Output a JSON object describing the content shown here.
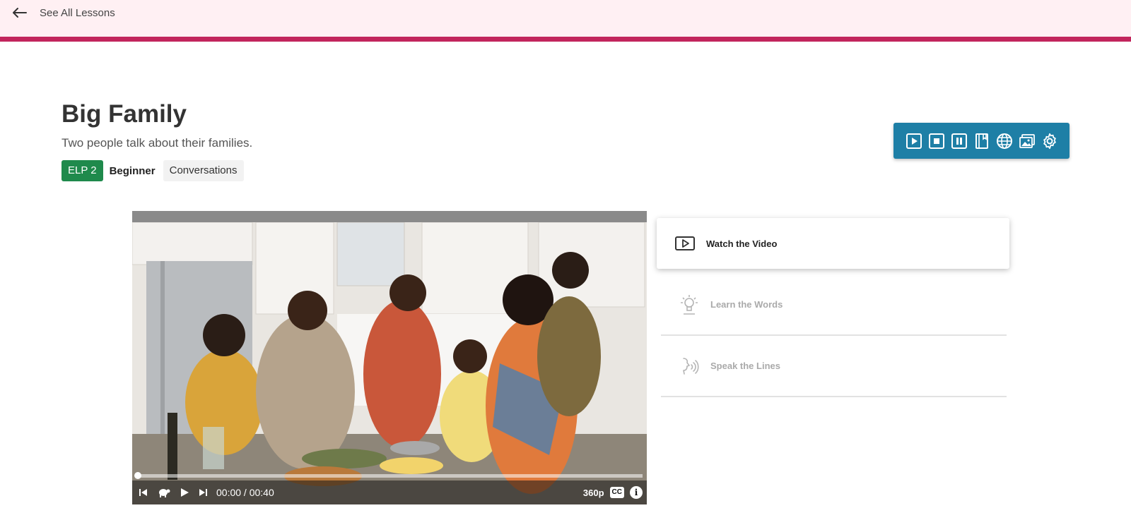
{
  "nav": {
    "back_label": "See All Lessons"
  },
  "lesson": {
    "title": "Big Family",
    "subtitle": "Two people talk about their families.",
    "level_code": "ELP 2",
    "level_name": "Beginner",
    "category": "Conversations"
  },
  "toolbar": {
    "buttons": [
      "play-icon",
      "stop-icon",
      "pause-icon",
      "notebook-icon",
      "globe-icon",
      "picture-icon",
      "gear-icon"
    ]
  },
  "video": {
    "time": "00:00 / 00:40",
    "quality": "360p",
    "cc_label": "CC",
    "info_label": "i",
    "progress": 0
  },
  "steps": [
    {
      "label": "Watch the Video",
      "icon": "video-play-icon",
      "active": true
    },
    {
      "label": "Learn the Words",
      "icon": "lightbulb-icon",
      "active": false
    },
    {
      "label": "Speak the Lines",
      "icon": "speak-icon",
      "active": false
    }
  ],
  "colors": {
    "accent_bar": "#c2255c",
    "header_bg": "#fff0f3",
    "toolbar_bg": "#1e7fa6",
    "level_badge": "#1f8a4c"
  }
}
